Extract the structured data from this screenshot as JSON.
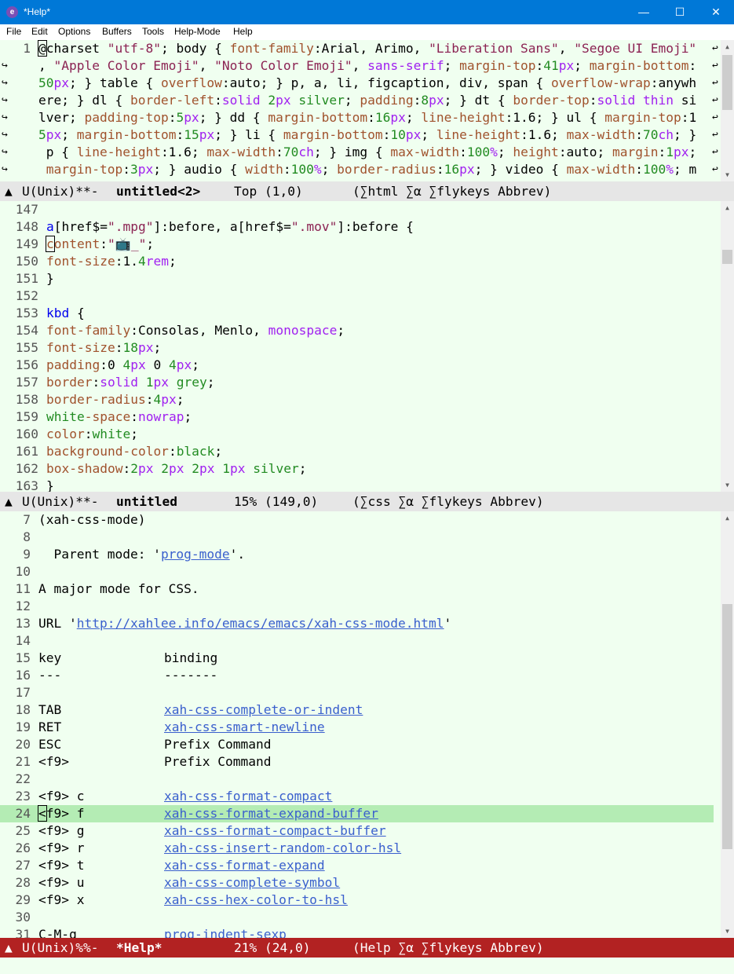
{
  "window": {
    "title": "*Help*",
    "icon_glyph": "e",
    "controls": {
      "minimize": "—",
      "maximize": "☐",
      "close": "✕"
    }
  },
  "menu": [
    "File",
    "Edit",
    "Options",
    "Buffers",
    "Tools",
    "Help-Mode",
    "Help"
  ],
  "top_pane": {
    "lines": [
      {
        "ln": "1",
        "text": "@charset \"utf-8\"; body { font-family:Arial, Arimo, \"Liberation Sans\", \"Segoe UI Emoji\""
      },
      {
        "ln": "",
        "text": ", \"Apple Color Emoji\", \"Noto Color Emoji\", sans-serif; margin-top:41px; margin-bottom:"
      },
      {
        "ln": "",
        "text": "50px; } table { overflow:auto; } p, a, li, figcaption, div, span { overflow-wrap:anywh"
      },
      {
        "ln": "",
        "text": "ere; } dl { border-left:solid 2px silver; padding:8px; } dt { border-top:solid thin si"
      },
      {
        "ln": "",
        "text": "lver; padding-top:5px; } dd { margin-bottom:16px; line-height:1.6; } ul { margin-top:1"
      },
      {
        "ln": "",
        "text": "5px; margin-bottom:15px; } li { margin-bottom:10px; line-height:1.6; max-width:70ch; }"
      },
      {
        "ln": "",
        "text": " p { line-height:1.6; max-width:70ch; } img { max-width:100%; height:auto; margin:1px;"
      },
      {
        "ln": "",
        "text": " margin-top:3px; } audio { width:100%; border-radius:16px; } video { max-width:100%; m"
      }
    ],
    "modeline": {
      "triangle": "▲",
      "state": "U(Unix)**-",
      "buffer": "untitled<2>",
      "position": "Top (1,0)",
      "modes": "(∑html ∑α ∑flykeys Abbrev)"
    }
  },
  "middle_pane": {
    "lines": [
      {
        "ln": "147",
        "text": ""
      },
      {
        "ln": "148",
        "text": "a[href$=\".mpg\"]:before, a[href$=\".mov\"]:before {"
      },
      {
        "ln": "149",
        "text": "content:\"📺_\";"
      },
      {
        "ln": "150",
        "text": "font-size:1.4rem;"
      },
      {
        "ln": "151",
        "text": "}"
      },
      {
        "ln": "152",
        "text": ""
      },
      {
        "ln": "153",
        "text": "kbd {"
      },
      {
        "ln": "154",
        "text": "font-family:Consolas, Menlo, monospace;"
      },
      {
        "ln": "155",
        "text": "font-size:18px;"
      },
      {
        "ln": "156",
        "text": "padding:0 4px 0 4px;"
      },
      {
        "ln": "157",
        "text": "border:solid 1px grey;"
      },
      {
        "ln": "158",
        "text": "border-radius:4px;"
      },
      {
        "ln": "159",
        "text": "white-space:nowrap;"
      },
      {
        "ln": "160",
        "text": "color:white;"
      },
      {
        "ln": "161",
        "text": "background-color:black;"
      },
      {
        "ln": "162",
        "text": "box-shadow:2px 2px 2px 1px silver;"
      },
      {
        "ln": "163",
        "text": "}"
      }
    ],
    "modeline": {
      "triangle": "▲",
      "state": "U(Unix)**-",
      "buffer": "untitled",
      "position": "15% (149,0)",
      "modes": "(∑css ∑α ∑flykeys Abbrev)"
    }
  },
  "help_pane": {
    "lines": [
      {
        "ln": "7",
        "text": "(xah-css-mode)"
      },
      {
        "ln": "8",
        "text": ""
      },
      {
        "ln": "9",
        "text": "  Parent mode: 'prog-mode'."
      },
      {
        "ln": "10",
        "text": ""
      },
      {
        "ln": "11",
        "text": "A major mode for CSS."
      },
      {
        "ln": "12",
        "text": ""
      },
      {
        "ln": "13",
        "text": "URL 'http://xahlee.info/emacs/emacs/xah-css-mode.html'"
      },
      {
        "ln": "14",
        "text": ""
      },
      {
        "ln": "15",
        "key": "key",
        "binding": "binding",
        "link": false
      },
      {
        "ln": "16",
        "key": "---",
        "binding": "-------",
        "link": false
      },
      {
        "ln": "17",
        "text": ""
      },
      {
        "ln": "18",
        "key": "TAB",
        "binding": "xah-css-complete-or-indent",
        "link": true
      },
      {
        "ln": "19",
        "key": "RET",
        "binding": "xah-css-smart-newline",
        "link": true
      },
      {
        "ln": "20",
        "key": "ESC",
        "binding": "Prefix Command",
        "link": false
      },
      {
        "ln": "21",
        "key": "<f9>",
        "binding": "Prefix Command",
        "link": false
      },
      {
        "ln": "22",
        "text": ""
      },
      {
        "ln": "23",
        "key": "<f9> c",
        "binding": "xah-css-format-compact",
        "link": true
      },
      {
        "ln": "24",
        "key": "<f9> f",
        "binding": "xah-css-format-expand-buffer",
        "link": true,
        "highlight": true
      },
      {
        "ln": "25",
        "key": "<f9> g",
        "binding": "xah-css-format-compact-buffer",
        "link": true
      },
      {
        "ln": "26",
        "key": "<f9> r",
        "binding": "xah-css-insert-random-color-hsl",
        "link": true
      },
      {
        "ln": "27",
        "key": "<f9> t",
        "binding": "xah-css-format-expand",
        "link": true
      },
      {
        "ln": "28",
        "key": "<f9> u",
        "binding": "xah-css-complete-symbol",
        "link": true
      },
      {
        "ln": "29",
        "key": "<f9> x",
        "binding": "xah-css-hex-color-to-hsl",
        "link": true
      },
      {
        "ln": "30",
        "text": ""
      },
      {
        "ln": "31",
        "key": "C-M-q",
        "binding": "prog-indent-sexp",
        "link": true
      }
    ],
    "modeline": {
      "triangle": "▲",
      "state": "U(Unix)%%-",
      "buffer": "*Help*",
      "position": "21% (24,0)",
      "modes": "(Help ∑α ∑flykeys Abbrev)"
    }
  },
  "colors": {
    "accent": "#0078d7",
    "active_modeline": "#b22222",
    "buffer_bg": "#f0fff0",
    "highlight": "#b4ecb4"
  }
}
